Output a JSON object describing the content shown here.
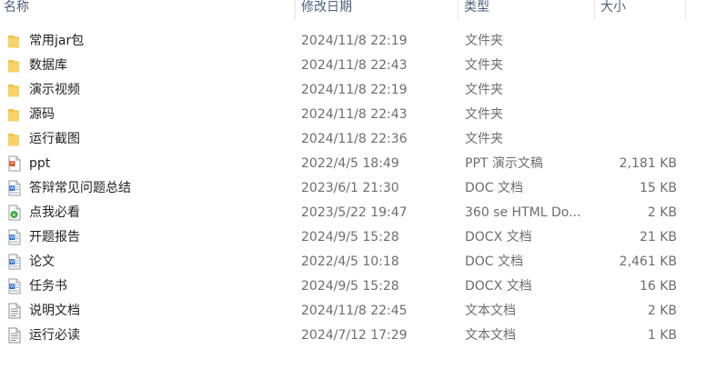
{
  "columns": {
    "name": "名称",
    "modified": "修改日期",
    "type": "类型",
    "size": "大小"
  },
  "files": [
    {
      "name": "常用jar包",
      "modified": "2024/11/8 22:19",
      "type": "文件夹",
      "size": "",
      "icon": "folder-icon"
    },
    {
      "name": "数据库",
      "modified": "2024/11/8 22:43",
      "type": "文件夹",
      "size": "",
      "icon": "folder-icon"
    },
    {
      "name": "演示视频",
      "modified": "2024/11/8 22:19",
      "type": "文件夹",
      "size": "",
      "icon": "folder-icon"
    },
    {
      "name": "源码",
      "modified": "2024/11/8 22:43",
      "type": "文件夹",
      "size": "",
      "icon": "folder-icon"
    },
    {
      "name": "运行截图",
      "modified": "2024/11/8 22:36",
      "type": "文件夹",
      "size": "",
      "icon": "folder-icon"
    },
    {
      "name": "ppt",
      "modified": "2022/4/5 18:49",
      "type": "PPT 演示文稿",
      "size": "2,181 KB",
      "icon": "ppt-file-icon"
    },
    {
      "name": "答辩常见问题总结",
      "modified": "2023/6/1 21:30",
      "type": "DOC 文档",
      "size": "15 KB",
      "icon": "doc-file-icon"
    },
    {
      "name": "点我必看",
      "modified": "2023/5/22 19:47",
      "type": "360 se HTML Do...",
      "size": "2 KB",
      "icon": "html-file-icon"
    },
    {
      "name": "开题报告",
      "modified": "2024/9/5 15:28",
      "type": "DOCX 文档",
      "size": "21 KB",
      "icon": "docx-file-icon"
    },
    {
      "name": "论文",
      "modified": "2022/4/5 10:18",
      "type": "DOC 文档",
      "size": "2,461 KB",
      "icon": "doc-file-icon"
    },
    {
      "name": "任务书",
      "modified": "2024/9/5 15:28",
      "type": "DOCX 文档",
      "size": "16 KB",
      "icon": "docx-file-icon"
    },
    {
      "name": "说明文档",
      "modified": "2024/11/8 22:45",
      "type": "文本文档",
      "size": "2 KB",
      "icon": "text-file-icon"
    },
    {
      "name": "运行必读",
      "modified": "2024/7/12 17:29",
      "type": "文本文档",
      "size": "1 KB",
      "icon": "text-file-icon"
    }
  ],
  "colors": {
    "header_text": "#4c607a",
    "name_text": "#1f1f1f",
    "detail_text": "#6d6d6d",
    "folder": "#f2c34b",
    "word_blue": "#2b6cd0",
    "ppt_orange": "#d9532c",
    "html_green": "#3aa63a"
  }
}
